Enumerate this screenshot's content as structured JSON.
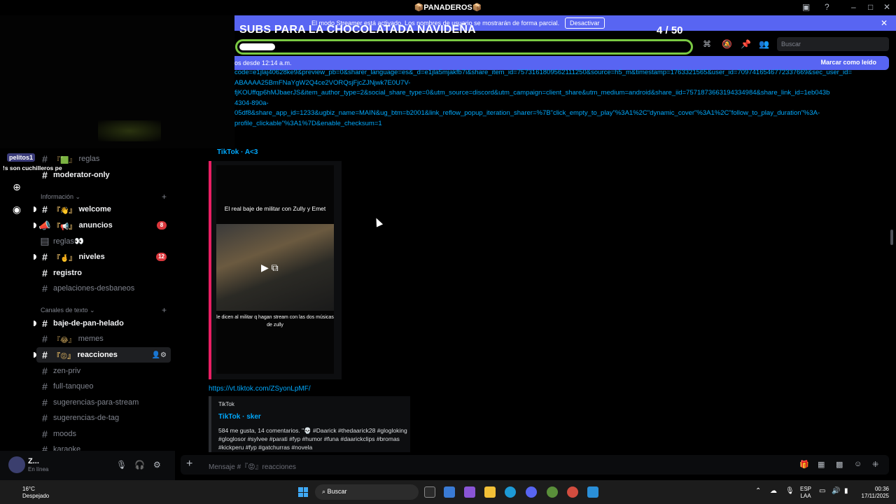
{
  "window": {
    "title": "📦PANADEROS📦"
  },
  "streamer_bar": {
    "message": "El modo Streamer está activado. Los nombres de usuario se mostrarán de forma parcial.",
    "button": "Desactivar"
  },
  "overlay": {
    "title": "SUBS PARA LA CHOCOLATADA NAVIDEÑA",
    "count": "4  / 50",
    "progress_fraction": 0.08
  },
  "search": {
    "placeholder": "Buscar"
  },
  "new_messages": {
    "text": "os desde 12:14 a.m.",
    "mark_read": "Marcar como leído"
  },
  "message": {
    "url_lines": [
      "code=e1jlaj40628ke9&preview_pb=0&sharer_language=es&_d=e1jla5mjakfb7i&share_item_id=7573161809562111250&source=h5_m&timestamp=1763321565&user_id=7097416546772337669&sec_user_id=",
      "ABAAAA25BmFNaYgW2Q4ce2VORQsjFjcZJNjwk7E0U7V-",
      "fjKOUffqp6hMJbaerJS&item_author_type=2&social_share_type=0&utm_source=discord&utm_campaign=client_share&utm_medium=android&share_iid=7571873663194334984&share_link_id=1eb043b",
      "4304-890a-",
      "05df8&share_app_id=1233&ugbiz_name=MAIN&ug_btm=b2001&link_reflow_popup_iteration_sharer=%7B\"click_empty_to_play\"%3A1%2C\"dynamic_cover\"%3A1%2C\"follow_to_play_duration\"%3A-",
      "profile_clickable\"%3A1%7D&enable_checksum=1"
    ],
    "embed_title": "TikTok · A<3",
    "video_caption_top": "El real baje de militar con Zully y Emet",
    "video_caption_bottom": "le dicen al militar q hagan stream con las dos músicas de zully"
  },
  "message2": {
    "link": "https://vt.tiktok.com/ZSyonLpMF/",
    "provider": "TikTok",
    "title": "TikTok · sker",
    "description": "584 me gusta, 14 comentarios. \"💀 #Daarick #thedaarick28 #glogloking #gloglosor #sylvee #parati #fyp #humor #funa #daarickclips #bromas #kickperu #fyp #gatchurras #novela"
  },
  "stream_chat": {
    "user": "pelitos1",
    "text": "!s son cuchilleros pe"
  },
  "sidebar": {
    "top_items": [
      {
        "name": "reglas",
        "emoji": "『🟩』"
      },
      {
        "name": "moderator-only",
        "emoji": ""
      }
    ],
    "cat_info": "Información ⌄",
    "info_channels": [
      {
        "name": "welcome",
        "emoji": "『👋』",
        "badge": ""
      },
      {
        "name": "anuncios",
        "emoji": "『📢』",
        "badge": "8"
      },
      {
        "name": "reglas👀",
        "emoji": "",
        "badge": ""
      },
      {
        "name": "niveles",
        "emoji": "『🤞』",
        "badge": "12"
      },
      {
        "name": "registro",
        "emoji": "",
        "badge": ""
      },
      {
        "name": "apelaciones-desbaneos",
        "emoji": "",
        "badge": ""
      }
    ],
    "cat_text": "Canales de texto ⌄",
    "text_channels": [
      {
        "name": "baje-de-pan-helado",
        "emoji": ""
      },
      {
        "name": "memes",
        "emoji": "『😂』"
      },
      {
        "name": "reacciones",
        "emoji": "『😡』"
      },
      {
        "name": "zen-priv",
        "emoji": ""
      },
      {
        "name": "full-tanqueo",
        "emoji": ""
      },
      {
        "name": "sugerencias-para-stream",
        "emoji": ""
      },
      {
        "name": "sugerencias-de-tag",
        "emoji": ""
      },
      {
        "name": "moods",
        "emoji": ""
      },
      {
        "name": "karaoke",
        "emoji": ""
      }
    ]
  },
  "user": {
    "name": "Z...",
    "status": "En línea"
  },
  "composer": {
    "placeholder": "Mensaje #『😡』reacciones"
  },
  "taskbar": {
    "temp": "16°C",
    "weather": "Despejado",
    "search": "Buscar",
    "lang1": "ESP",
    "lang2": "LAA",
    "time": "00:36",
    "date": "17/11/2025"
  },
  "colors": {
    "accent": "#5865f2",
    "progress": "#7ac943",
    "link": "#00a8fc",
    "embed_bar": "#e91e63",
    "badge": "#da373c"
  }
}
